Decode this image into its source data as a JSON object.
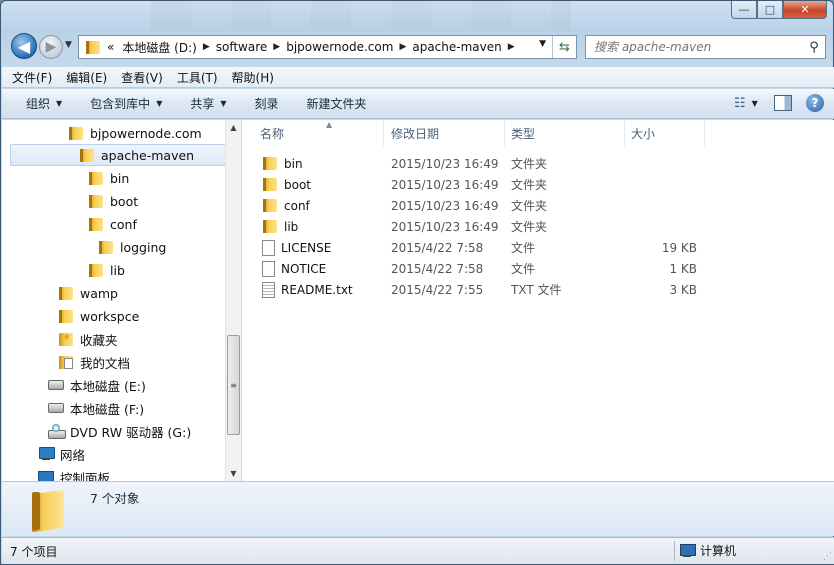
{
  "window": {
    "minimize_label": "—",
    "maximize_label": "□",
    "close_label": "✕"
  },
  "nav": {
    "back_label": "◀",
    "forward_label": "▶"
  },
  "address": {
    "overflow": "«",
    "crumbs": [
      "本地磁盘 (D:)",
      "software",
      "bjpowernode.com",
      "apache-maven"
    ]
  },
  "search": {
    "placeholder": "搜索 apache-maven"
  },
  "menu": {
    "items": [
      "文件(F)",
      "编辑(E)",
      "查看(V)",
      "工具(T)",
      "帮助(H)"
    ]
  },
  "toolbar": {
    "organize": "组织",
    "include_in_library": "包含到库中",
    "share": "共享",
    "burn": "刻录",
    "new_folder": "新建文件夹"
  },
  "tree": {
    "items": [
      {
        "label": "bjpowernode.com",
        "icon": "folder"
      },
      {
        "label": "apache-maven",
        "icon": "folder",
        "selected": true
      },
      {
        "label": "bin",
        "icon": "folder"
      },
      {
        "label": "boot",
        "icon": "folder"
      },
      {
        "label": "conf",
        "icon": "folder"
      },
      {
        "label": "logging",
        "icon": "folder"
      },
      {
        "label": "lib",
        "icon": "folder"
      },
      {
        "label": "wamp",
        "icon": "folder"
      },
      {
        "label": "workspce",
        "icon": "folder"
      },
      {
        "label": "收藏夹",
        "icon": "favorites"
      },
      {
        "label": "我的文档",
        "icon": "documents"
      },
      {
        "label": "本地磁盘 (E:)",
        "icon": "drive"
      },
      {
        "label": "本地磁盘 (F:)",
        "icon": "drive"
      },
      {
        "label": "DVD RW 驱动器 (G:)",
        "icon": "dvd-drive"
      },
      {
        "label": "网络",
        "icon": "network"
      },
      {
        "label": "控制面板",
        "icon": "control-panel"
      }
    ]
  },
  "columns": {
    "name": "名称",
    "date": "修改日期",
    "type": "类型",
    "size": "大小"
  },
  "files": [
    {
      "name": "bin",
      "date": "2015/10/23 16:49",
      "type": "文件夹",
      "size": "",
      "icon": "folder"
    },
    {
      "name": "boot",
      "date": "2015/10/23 16:49",
      "type": "文件夹",
      "size": "",
      "icon": "folder"
    },
    {
      "name": "conf",
      "date": "2015/10/23 16:49",
      "type": "文件夹",
      "size": "",
      "icon": "folder"
    },
    {
      "name": "lib",
      "date": "2015/10/23 16:49",
      "type": "文件夹",
      "size": "",
      "icon": "folder"
    },
    {
      "name": "LICENSE",
      "date": "2015/4/22 7:58",
      "type": "文件",
      "size": "19 KB",
      "icon": "file"
    },
    {
      "name": "NOTICE",
      "date": "2015/4/22 7:58",
      "type": "文件",
      "size": "1 KB",
      "icon": "file"
    },
    {
      "name": "README.txt",
      "date": "2015/4/22 7:55",
      "type": "TXT 文件",
      "size": "3 KB",
      "icon": "text-file"
    }
  ],
  "details": {
    "summary": "7 个对象"
  },
  "status": {
    "item_count": "7 个项目",
    "location": "计算机"
  }
}
